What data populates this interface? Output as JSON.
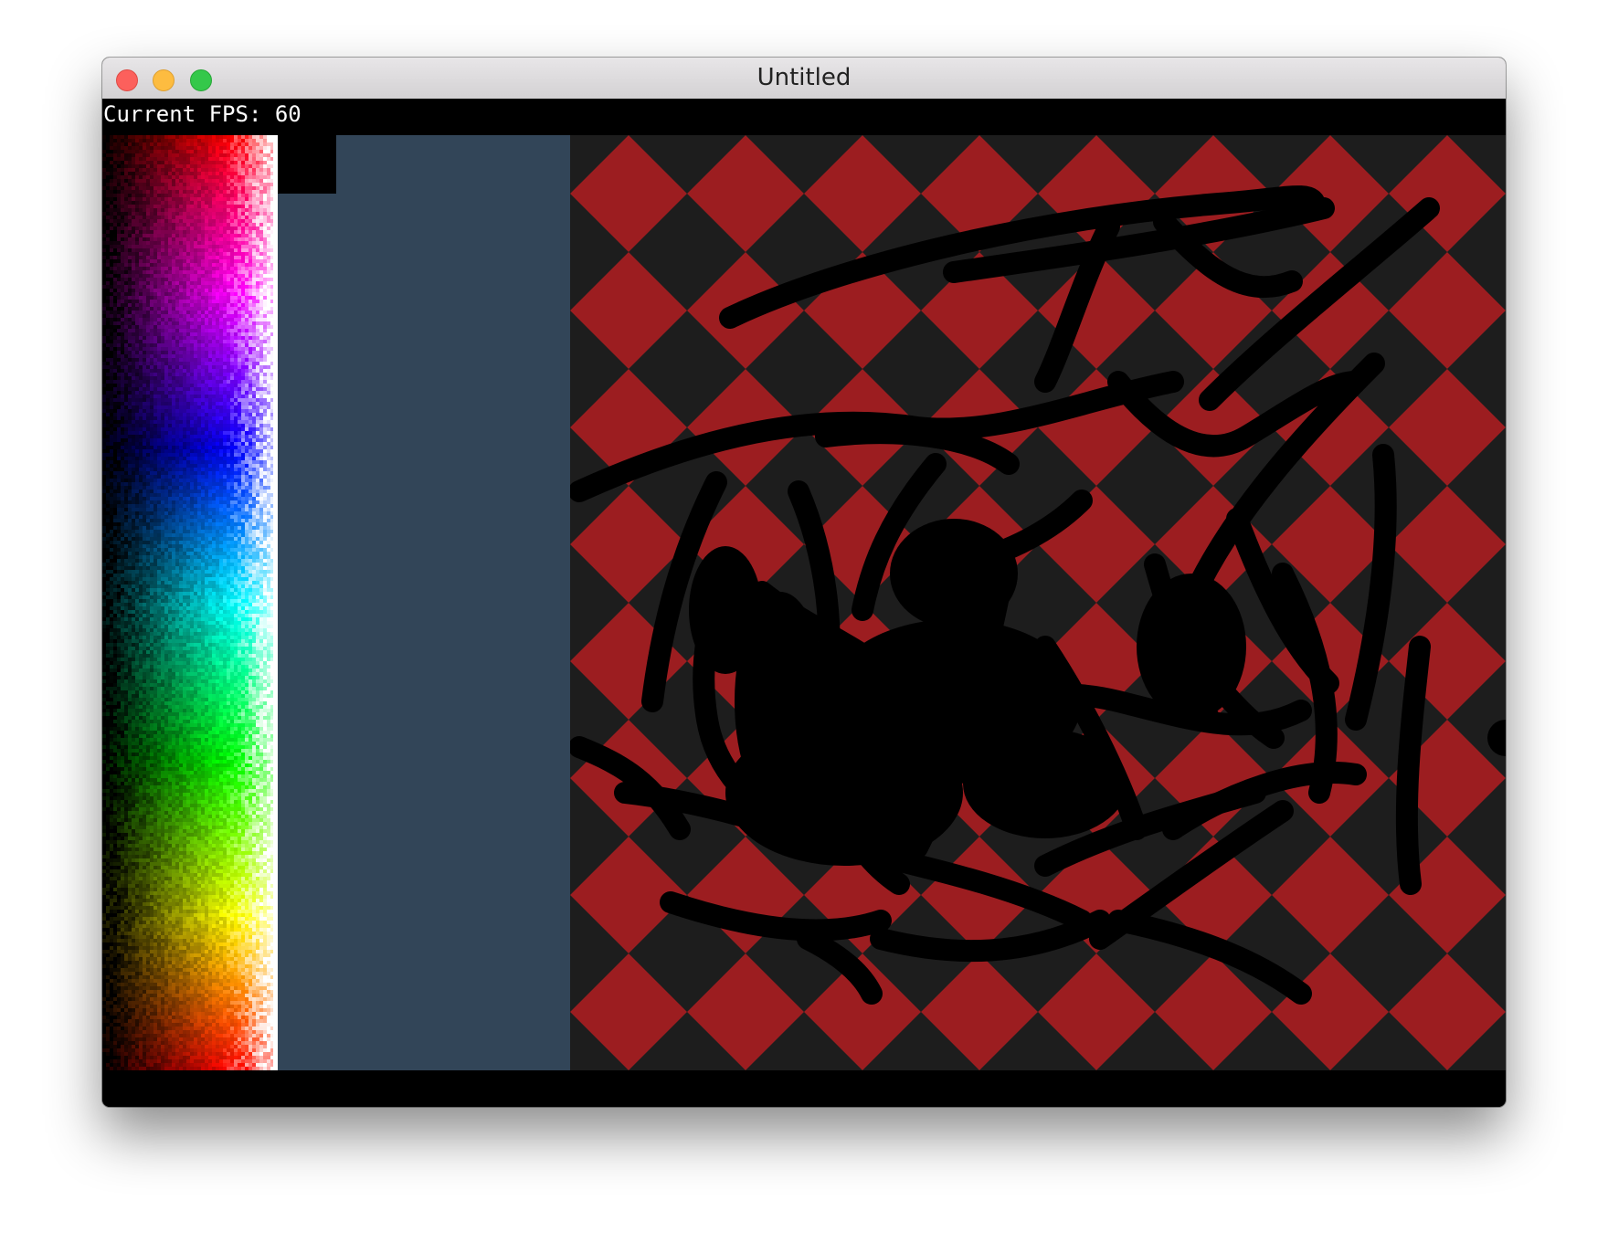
{
  "window": {
    "title": "Untitled"
  },
  "overlay": {
    "fps_label": "Current FPS: 60"
  },
  "colors": {
    "desktop": "#ffffff",
    "window_background": "#000000",
    "panel_background": "#324558",
    "checker_red": "#9c1d20",
    "checker_dark_red": "#5e1f20",
    "checker_charcoal": "#1d1d1d",
    "ink": "#000000",
    "selected_color": "#000000"
  },
  "icons": {
    "close": "close-icon",
    "minimize": "minimize-icon",
    "zoom": "zoom-icon"
  }
}
